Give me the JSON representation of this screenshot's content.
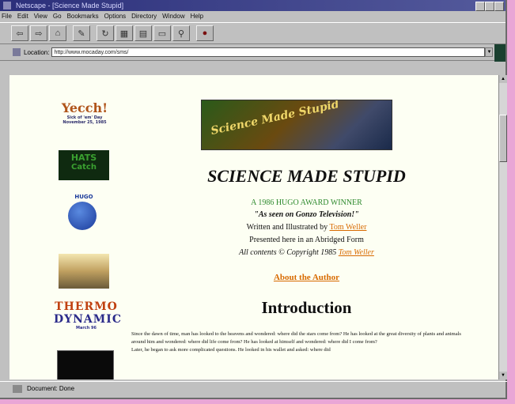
{
  "window": {
    "title": "Netscape - [Science Made Stupid]"
  },
  "menu": [
    "File",
    "Edit",
    "View",
    "Go",
    "Bookmarks",
    "Options",
    "Directory",
    "Window",
    "Help"
  ],
  "toolbar": {
    "buttons": [
      {
        "name": "back-button",
        "icon": "back-icon",
        "glyph": "⇦"
      },
      {
        "name": "forward-button",
        "icon": "forward-icon",
        "glyph": "⇨"
      },
      {
        "name": "home-button",
        "icon": "home-icon",
        "glyph": "⌂"
      },
      {
        "name": "edit-button",
        "icon": "pencil-icon",
        "glyph": "✎"
      },
      {
        "name": "reload-button",
        "icon": "reload-icon",
        "glyph": "↻"
      },
      {
        "name": "images-button",
        "icon": "images-icon",
        "glyph": "▦"
      },
      {
        "name": "open-button",
        "icon": "open-icon",
        "glyph": "▤"
      },
      {
        "name": "print-button",
        "icon": "print-icon",
        "glyph": "▭"
      },
      {
        "name": "find-button",
        "icon": "find-icon",
        "glyph": "⚲"
      },
      {
        "name": "stop-button",
        "icon": "stop-icon",
        "glyph": "●"
      }
    ]
  },
  "location": {
    "label": "Location:",
    "url": "http://www.mocaday.com/sms/"
  },
  "sidebar": {
    "yecch_title": "Yecch!",
    "yecch_sub": "Sick of 'em' Day\nNovember 25, 1985",
    "hats_line1": "HATS",
    "hats_line2": "Catch",
    "hugo_text": "HUGO",
    "thermo_line1": "THERMO",
    "thermo_line2": "DYNAMIC",
    "thermo_sub": "March 96"
  },
  "page": {
    "banner_text": "Science Made Stupid",
    "title": "SCIENCE MADE STUPID",
    "award": "A 1986 HUGO AWARD WINNER",
    "tagline": "\"As seen on Gonzo Television!\"",
    "written_by": "Written and Illustrated by",
    "author": "Tom Weller",
    "presented": "Presented here in an Abridged Form",
    "copyright": "All contents © Copyright 1985",
    "copyright_author": "Tom Weller",
    "about_link": "About the Author",
    "intro_heading": "Introduction",
    "paragraph1": "Since the dawn of time, man has looked to the heavens and wondered: where did the stars come from? He has looked at the great diversity of plants and animals around him and wondered: where did life come from? He has looked at himself and wondered: where did I come from?",
    "paragraph2": "Later, he began to ask more complicated questions. He looked in his wallet and asked: where did"
  },
  "status": {
    "text": "Document: Done"
  },
  "colors": {
    "link": "#d86a00",
    "award": "#2e8a2e",
    "page_bg": "#fdfff3"
  }
}
